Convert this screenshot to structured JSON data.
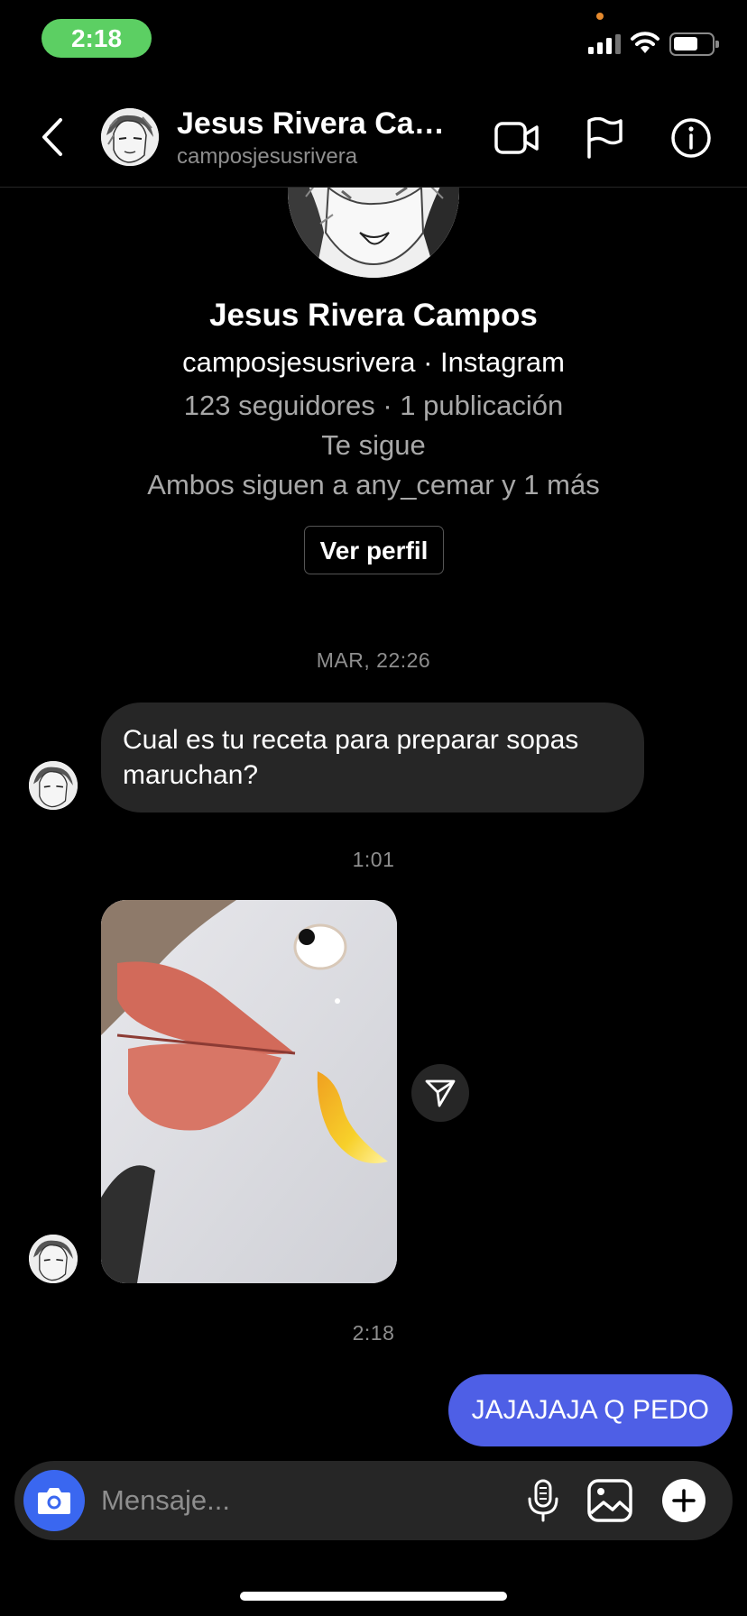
{
  "status_bar": {
    "time": "2:18",
    "time_pill_color": "#5ccf63",
    "signal_icon": "cellular-signal-icon",
    "wifi_icon": "wifi-icon",
    "battery_icon": "battery-icon",
    "battery_level": 0.55
  },
  "header": {
    "name": "Jesus Rivera Campos",
    "username": "camposjesusrivera",
    "icons": [
      "back-chevron-icon",
      "video-call-icon",
      "flag-icon",
      "info-icon"
    ]
  },
  "profile": {
    "name": "Jesus Rivera Campos",
    "subtitle": "camposjesusrivera · Instagram",
    "stats": "123 seguidores · 1 publicación",
    "follows_you": "Te sigue",
    "mutuals": "Ambos siguen a any_cemar y 1 más",
    "view_profile_label": "Ver perfil"
  },
  "thread": {
    "timestamps": [
      "MAR, 22:26",
      "1:01",
      "2:18"
    ],
    "incoming_message": "Cual es tu receta para preparar sopas maruchan?",
    "outgoing_message": "JAJAJAJA Q PEDO",
    "outgoing_color": "#4e5fe6",
    "incoming_color": "#262626"
  },
  "composer": {
    "placeholder": "Mensaje...",
    "camera_color": "#3a67f0",
    "icons": [
      "camera-icon",
      "microphone-icon",
      "gallery-icon",
      "plus-icon"
    ]
  }
}
